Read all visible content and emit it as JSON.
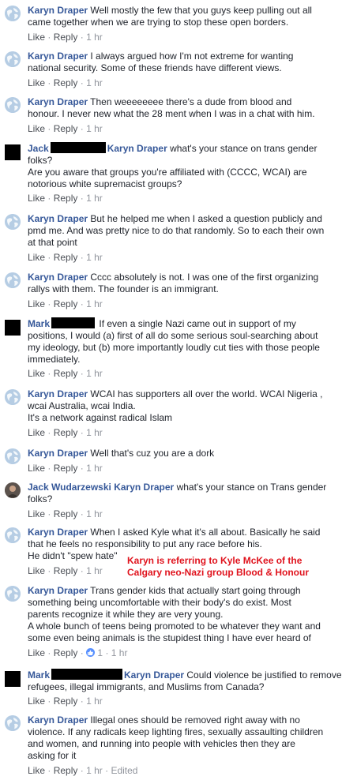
{
  "labels": {
    "like": "Like",
    "reply": "Reply",
    "sep": "·"
  },
  "annotation": {
    "line1": "Karyn is referring to Kyle McKee of the",
    "line2": "Calgary neo-Nazi group Blood & Honour"
  },
  "comments": [
    {
      "author": "Karyn Draper",
      "lines": [
        "Well mostly the few that you guys keep pulling out all",
        "came together when we are trying to stop these open borders."
      ],
      "time": "1 hr"
    },
    {
      "author": "Karyn Draper",
      "lines": [
        "I always argued how I'm not extreme for wanting",
        "national security. Some of these friends have different views."
      ],
      "time": "1 hr"
    },
    {
      "author": "Karyn Draper",
      "lines": [
        "Then weeeeeeee there's a dude from blood and",
        "honour. I never new what the 28 ment when I was in a chat with him."
      ],
      "time": "1 hr"
    },
    {
      "author": "Jack",
      "mention": "Karyn Draper",
      "lines": [
        "what's your stance on trans gender",
        "folks?",
        "Are you aware that groups you're affiliated with (CCCC, WCAI) are",
        "notorious white supremacist groups?"
      ],
      "time": "1 hr"
    },
    {
      "author": "Karyn Draper",
      "lines": [
        "But he helped me when I asked a question publicly and",
        "pmd me. And was pretty nice to do that randomly. So to each their own",
        "at that point"
      ],
      "time": "1 hr"
    },
    {
      "author": "Karyn Draper",
      "lines": [
        "Cccc absolutely is not. I was one of the first organizing",
        "rallys with them. The founder is an immigrant."
      ],
      "time": "1 hr"
    },
    {
      "author": "Mark",
      "lines": [
        "If even a single Nazi came out in support of my",
        "positions, I would (a) first of all do some serious soul-searching about",
        "my ideology, but (b) more importantly loudly cut ties with those people",
        "immediately."
      ],
      "time": "1 hr"
    },
    {
      "author": "Karyn Draper",
      "lines": [
        "WCAI has supporters all over the world. WCAI Nigeria ,",
        "wcai Australia, wcai India.",
        "It's a network against radical Islam"
      ],
      "time": "1 hr"
    },
    {
      "author": "Karyn Draper",
      "lines": [
        "Well that's cuz you are a dork"
      ],
      "time": "1 hr"
    },
    {
      "author": "Jack Wudarzewski",
      "mention": "Karyn Draper",
      "lines": [
        "what's your stance on Trans gender",
        "folks?"
      ],
      "time": "1 hr"
    },
    {
      "author": "Karyn Draper",
      "lines": [
        "When I asked Kyle what it's all about. Basically he said",
        "that he feels no responsibility to put any race before his.",
        "He didn't \"spew hate\""
      ],
      "time": "1 hr"
    },
    {
      "author": "Karyn Draper",
      "lines": [
        "Trans gender kids that actually start going through",
        "something being uncomfortable with their body's do exist. Most",
        "parents recognize it while they are very young.",
        "A whole bunch of teens being promoted to be whatever they want and",
        "some even being animals is the stupidest thing I have ever heard of"
      ],
      "time": "1 hr",
      "likes": "1"
    },
    {
      "author": "Mark",
      "mention": "Karyn Draper",
      "lines": [
        "Could violence be justified to remove",
        "refugees, illegal immigrants, and Muslims from Canada?"
      ],
      "time": "1 hr"
    },
    {
      "author": "Karyn Draper",
      "lines": [
        "Illegal ones should be removed right away with no",
        "violence. If any radicals keep lighting fires, sexually assaulting children",
        "and women, and running into people with vehicles then they are",
        "asking for it"
      ],
      "time": "1 hr",
      "edited": "Edited"
    }
  ]
}
